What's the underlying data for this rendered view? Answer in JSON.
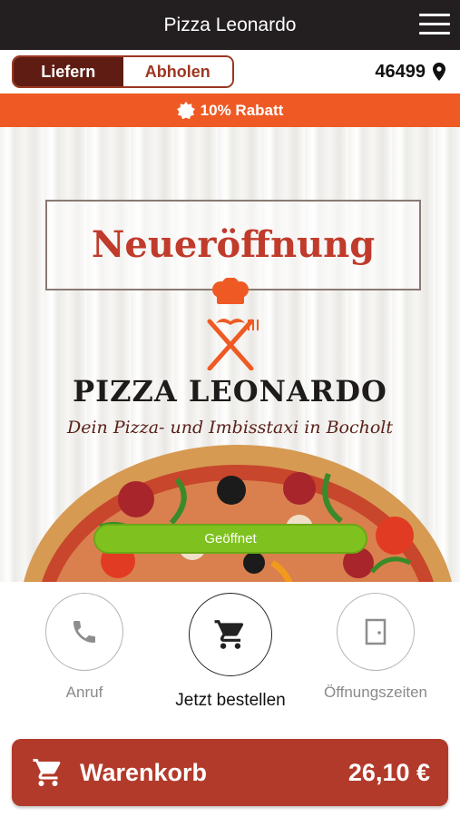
{
  "header": {
    "title": "Pizza Leonardo",
    "menu_icon": "hamburger-menu-icon"
  },
  "mode": {
    "options": [
      "Liefern",
      "Abholen"
    ],
    "selected": "Liefern"
  },
  "location": {
    "postal_code": "46499",
    "icon": "location-pin-icon"
  },
  "promo": {
    "text": "10% Rabatt",
    "icon": "badge-icon"
  },
  "hero": {
    "heading": "Neueröffnung",
    "brand": "PIZZA LEONARDO",
    "tagline": "Dein Pizza- und Imbisstaxi in Bocholt",
    "status": "Geöffnet"
  },
  "actions": [
    {
      "label": "Anruf",
      "icon": "phone-icon"
    },
    {
      "label": "Jetzt bestellen",
      "icon": "shopping-cart-icon"
    },
    {
      "label": "Öffnungszeiten",
      "icon": "door-icon"
    }
  ],
  "cart": {
    "label": "Warenkorb",
    "total": "26,10 €",
    "icon": "shopping-cart-icon"
  },
  "colors": {
    "top_bar": "#231f20",
    "accent_dark": "#5e1c12",
    "promo_orange": "#ef5a24",
    "open_green": "#7fc21f",
    "cart_red": "#b23a2a",
    "heading_red": "#c03b2b"
  }
}
